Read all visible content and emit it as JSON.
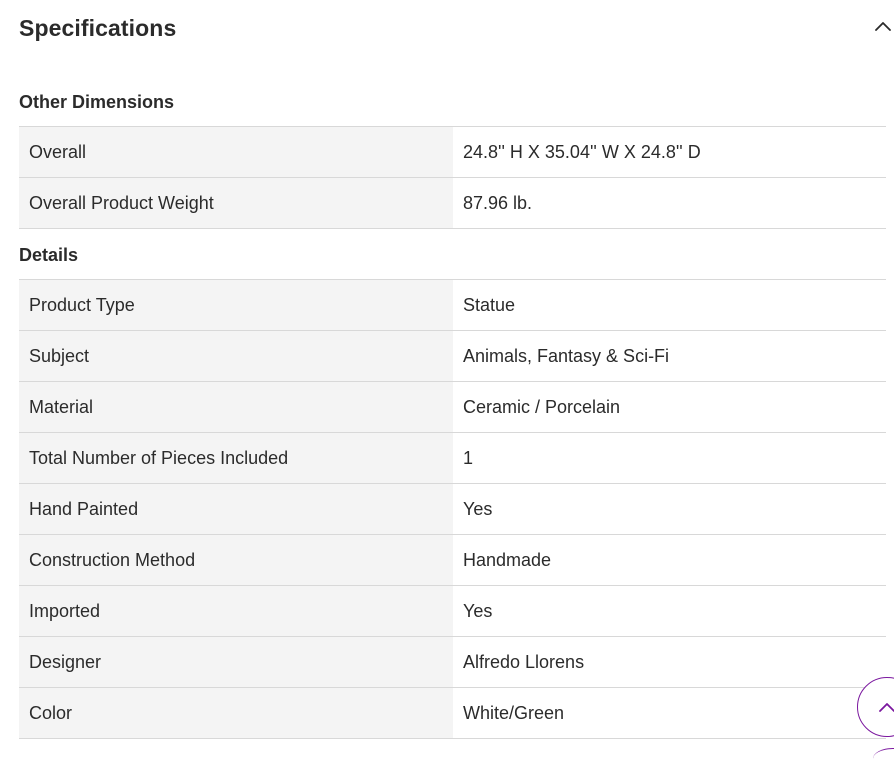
{
  "specifications": {
    "title": "Specifications",
    "toggle_icon": "chevron-up-icon",
    "sections": [
      {
        "heading": "Other Dimensions",
        "rows": [
          {
            "label": "Overall",
            "value": "24.8'' H X 35.04'' W X 24.8'' D"
          },
          {
            "label": "Overall Product Weight",
            "value": "87.96 lb."
          }
        ]
      },
      {
        "heading": "Details",
        "rows": [
          {
            "label": "Product Type",
            "value": "Statue"
          },
          {
            "label": "Subject",
            "value": "Animals, Fantasy & Sci-Fi"
          },
          {
            "label": "Material",
            "value": "Ceramic / Porcelain"
          },
          {
            "label": "Total Number of Pieces Included",
            "value": "1"
          },
          {
            "label": "Hand Painted",
            "value": "Yes"
          },
          {
            "label": "Construction Method",
            "value": "Handmade"
          },
          {
            "label": "Imported",
            "value": "Yes"
          },
          {
            "label": "Designer",
            "value": "Alfredo Llorens"
          },
          {
            "label": "Color",
            "value": "White/Green"
          }
        ]
      }
    ]
  },
  "scroll_top": {
    "icon": "chevron-up-icon",
    "accent_color": "#7b189f"
  },
  "colors": {
    "text": "#2b2b2b",
    "label_background": "#f4f4f4",
    "divider": "#d8d8d8"
  }
}
